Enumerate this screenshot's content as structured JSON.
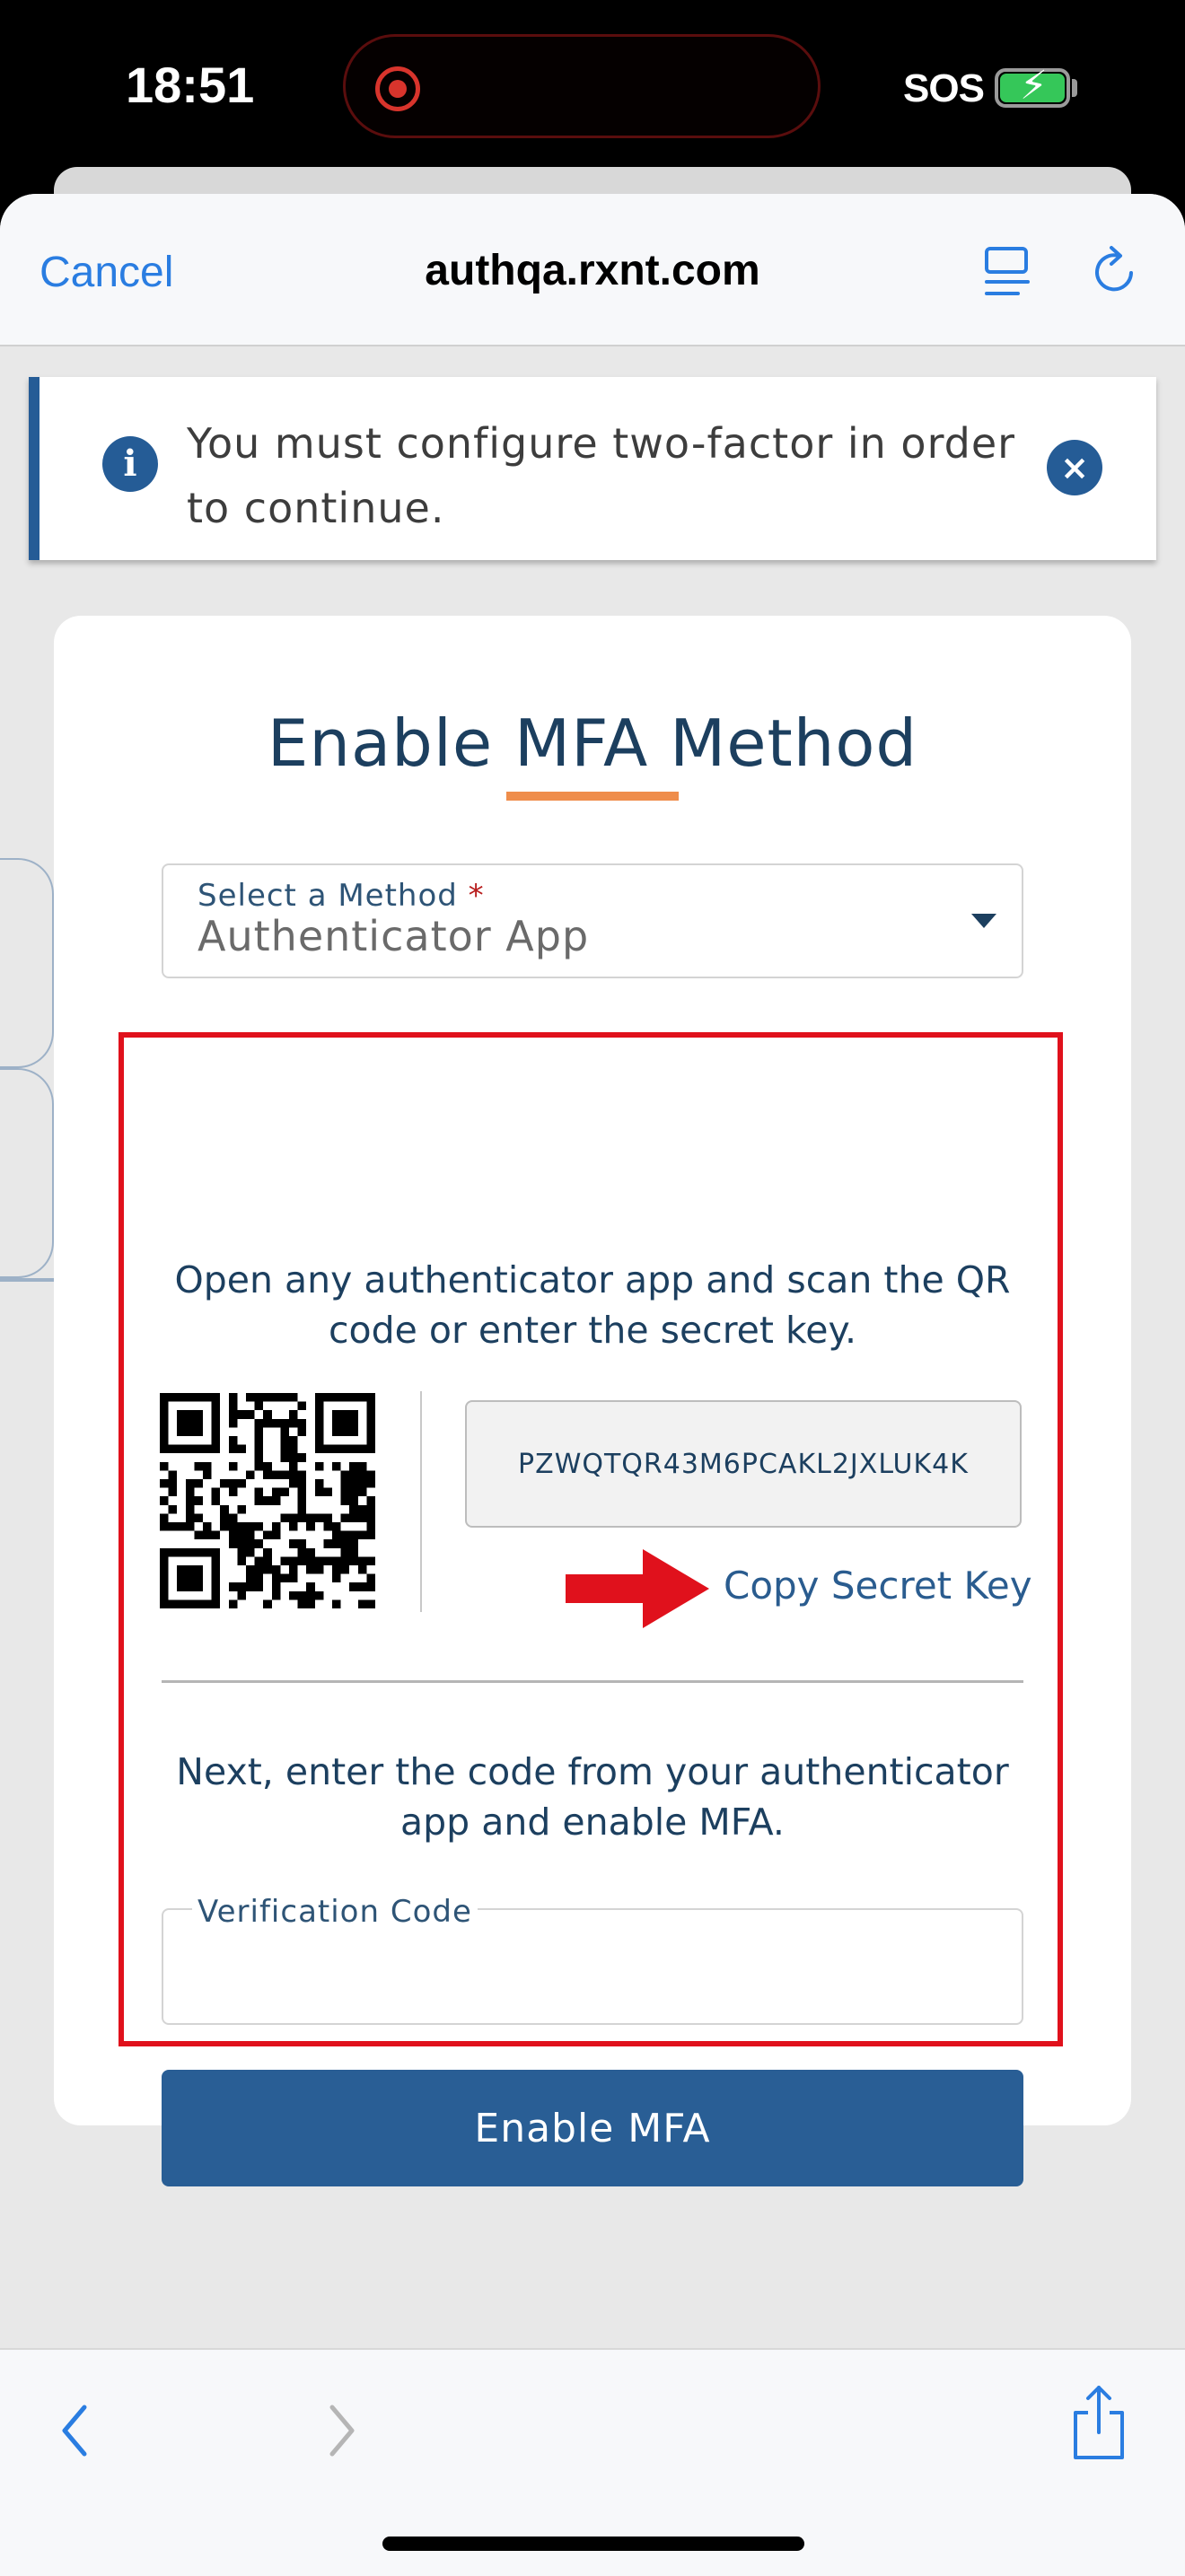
{
  "status_bar": {
    "time": "18:51",
    "carrier": "SOS",
    "icons": [
      "screen-recording-icon",
      "battery-charging-icon"
    ]
  },
  "browser": {
    "cancel_label": "Cancel",
    "url": "authqa.rxnt.com",
    "toolbar_icons": [
      "reader-icon",
      "reload-icon",
      "back-icon",
      "forward-icon",
      "share-icon"
    ]
  },
  "alert": {
    "message": "You must configure two-factor in order to continue.",
    "icon": "info-icon",
    "close_icon": "close-icon"
  },
  "card": {
    "title": "Enable MFA Method",
    "method_label": "Select a Method",
    "method_required_mark": "*",
    "method_value": "Authenticator App",
    "scan_instructions": "Open any authenticator app and scan the QR code or enter the secret key.",
    "secret_key": "PZWQTQR43M6PCAKL2JXLUK4K",
    "copy_key_label": "Copy Secret Key",
    "next_instructions": "Next, enter the code from your authenticator app and enable MFA.",
    "verification_label": "Verification Code",
    "verification_value": "",
    "enable_button_label": "Enable MFA"
  },
  "colors": {
    "primary": "#295e95",
    "title": "#1c3f5f",
    "accent_underline": "#ef8d4b",
    "highlight_box": "#e0111c",
    "ios_link": "#2a7de1",
    "required": "#b81d1d"
  }
}
